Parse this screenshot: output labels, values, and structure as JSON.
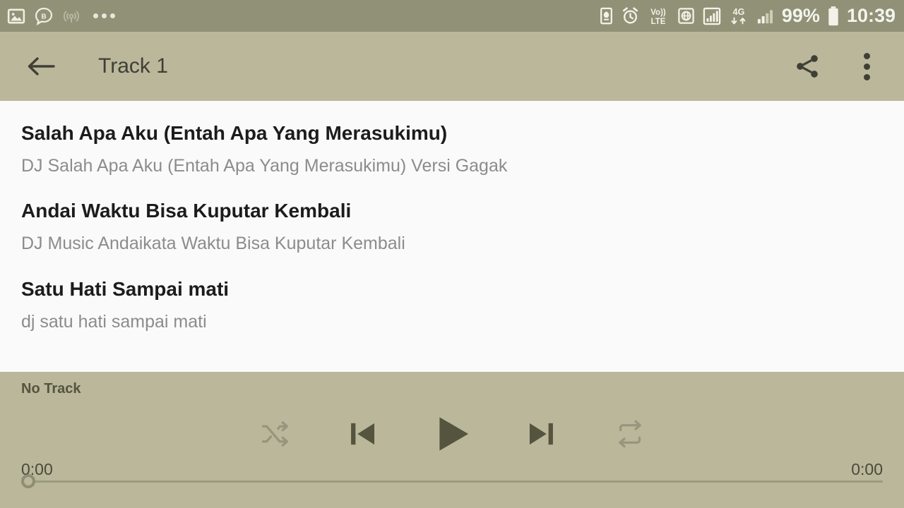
{
  "status_bar": {
    "notifications": [
      {
        "icon": "image-icon",
        "dim": false
      },
      {
        "icon": "bbm-chat-icon",
        "dim": false
      },
      {
        "icon": "wifi-hotspot-icon",
        "dim": true
      },
      {
        "icon": "more-notifications-icon",
        "dim": false
      }
    ],
    "right_icons": [
      {
        "icon": "battery-saver-icon"
      },
      {
        "icon": "alarm-clock-icon"
      },
      {
        "icon": "volte-icon",
        "label_top": "Vo))",
        "label_bottom": "LTE"
      },
      {
        "icon": "sim-globe-icon"
      },
      {
        "icon": "signal-bars-boxed-icon"
      },
      {
        "icon": "4g-data-icon",
        "label": "4G"
      },
      {
        "icon": "signal-bars-icon"
      }
    ],
    "battery_percent": "99%",
    "clock": "10:39"
  },
  "app_bar": {
    "back_label": "back",
    "title": "Track 1",
    "share_label": "share",
    "overflow_label": "more options"
  },
  "track_list": {
    "tracks": [
      {
        "title": "Salah Apa Aku (Entah Apa Yang Merasukimu)",
        "subtitle": "DJ Salah Apa Aku (Entah Apa Yang Merasukimu) Versi Gagak"
      },
      {
        "title": "Andai Waktu Bisa Kuputar Kembali",
        "subtitle": "DJ Music Andaikata Waktu Bisa Kuputar Kembali"
      },
      {
        "title": "Satu Hati Sampai mati",
        "subtitle": "dj satu hati sampai mati"
      }
    ]
  },
  "player": {
    "now_playing": "No Track",
    "shuffle_label": "shuffle",
    "previous_label": "previous",
    "play_label": "play",
    "next_label": "next",
    "repeat_label": "repeat",
    "elapsed_time": "0:00",
    "total_time": "0:00",
    "progress_percent": 0
  },
  "colors": {
    "status_bar_bg": "#919177",
    "app_bar_bg": "#bab79b",
    "list_bg": "#fafafa",
    "title_text": "#1c1c1c",
    "subtitle_text": "#8c8c8c",
    "icon_dark": "#3f3f35"
  }
}
